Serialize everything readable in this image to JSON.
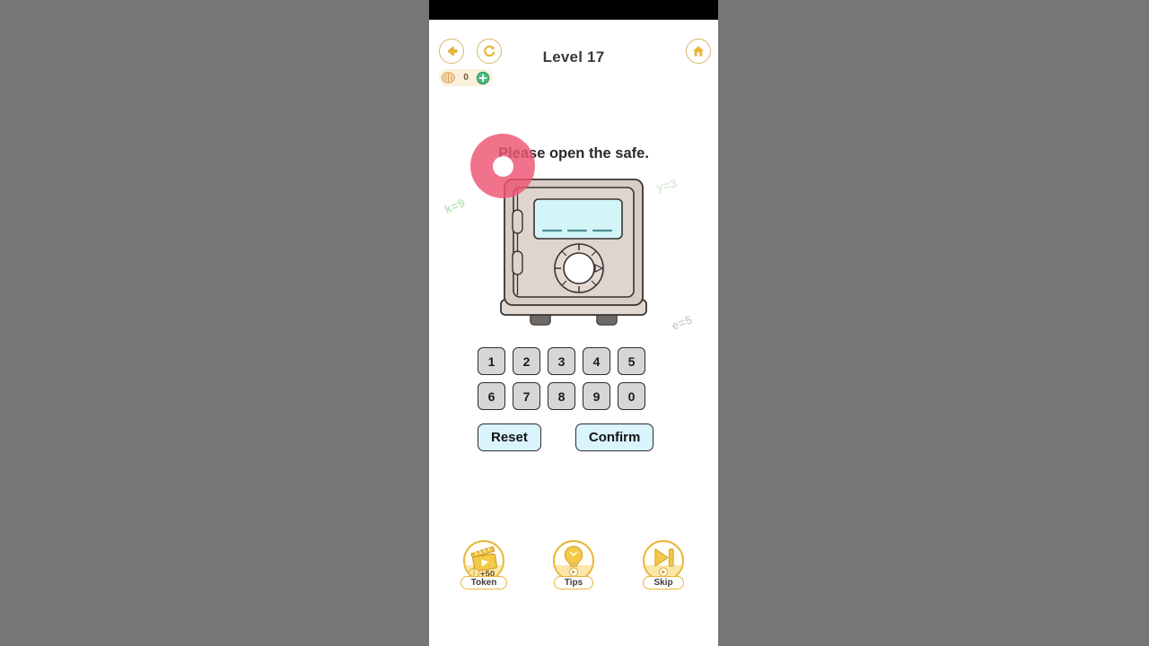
{
  "app": {
    "level_title": "Level 17"
  },
  "topbar": {
    "back_icon": "back-arrow-icon",
    "restart_icon": "restart-icon",
    "home_icon": "home-icon",
    "coin_icon": "brain-icon",
    "coin_count": "0",
    "add_icon": "plus-icon"
  },
  "stage": {
    "prompt": "Please open the safe.",
    "hints": [
      {
        "text": "k=9",
        "color": "#bfe6bf"
      },
      {
        "text": "y=3",
        "color": "#d9ead2"
      },
      {
        "text": "e=5",
        "color": "#cfcfcf"
      }
    ],
    "safe": {
      "display_value": "",
      "display_slots": 3,
      "body_color": "#d8ccc6",
      "screen_color": "#d3f5f8"
    },
    "touch_indicator": {
      "color": "#ef5572"
    }
  },
  "keypad": {
    "rows": [
      [
        "1",
        "2",
        "3",
        "4",
        "5"
      ],
      [
        "6",
        "7",
        "8",
        "9",
        "0"
      ]
    ]
  },
  "actions": {
    "reset_label": "Reset",
    "confirm_label": "Confirm"
  },
  "tools": [
    {
      "label": "Token",
      "icon": "video-clapper-icon",
      "badge": "+50"
    },
    {
      "label": "Tips",
      "icon": "lightbulb-icon",
      "badge": ""
    },
    {
      "label": "Skip",
      "icon": "skip-forward-icon",
      "badge": ""
    }
  ],
  "theme": {
    "accent_gold": "#e8b53a",
    "key_face": "#d6d6d6",
    "action_face": "#d9f4fb"
  }
}
